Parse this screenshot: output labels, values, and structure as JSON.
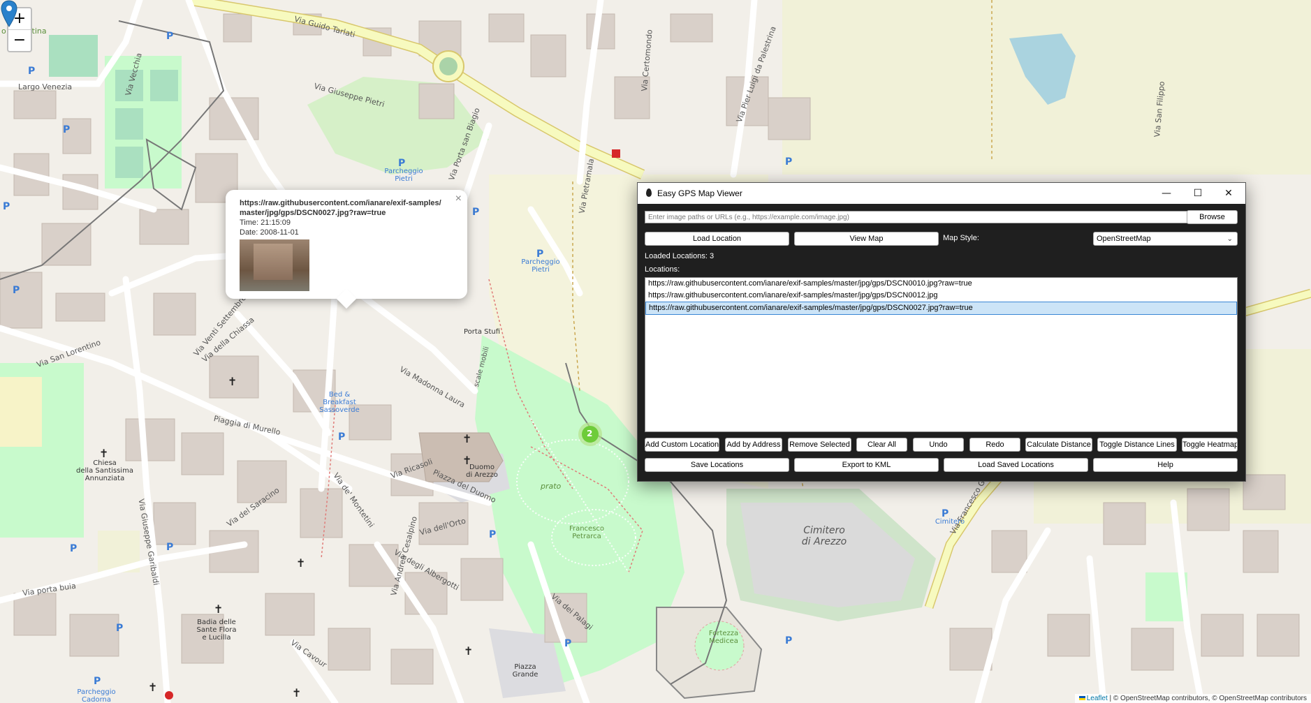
{
  "map": {
    "zoom_in": "+",
    "zoom_out": "−",
    "labels": {
      "via_guido_tarlati": "Via Guido Tarlati",
      "via_giuseppe_pietri": "Via Giuseppe Pietri",
      "via_madonna_laura": "Via Madonna Laura",
      "piaggia_di_murello": "Piaggia di Murello",
      "via_ricasoli": "Via Ricasoli",
      "piazza_del_duomo": "Piazza del Duomo",
      "duomo_di_arezzo": "Duomo\ndi Arezzo",
      "cimitero_di_arezzo": "Cimitero\ndi Arezzo",
      "porta_stufi": "Porta Stufi",
      "francesco_petrarca": "Francesco\nPetrarca",
      "fortezza_medicea": "Fortezza\nMedicea",
      "chiesa": "Chiesa\ndella Santissima\nAnnunziata",
      "badia": "Badia delle\nSante Flora\ne Lucilla",
      "bed_breakfast": "Bed &\nBreakfast\nSassoverde",
      "parcheggio_pietri": "Parcheggio\nPietri",
      "parcheggio_cadorna": "Parcheggio\nCadorna",
      "prato": "prato",
      "via_pietramala": "Via Pietramala",
      "via_cavour": "Via Cavour",
      "via_del_saracino": "Via del Saracino",
      "largo_venezia": "Largo Venezia",
      "via_vecchia": "Via Vecchia",
      "via_porta_buia": "Via porta buia",
      "via_dell_orto": "Via dell'Orto",
      "via_francesco_gamurrini": "Via Francesco Gamurrini",
      "via_san_filippo": "Via San Filippo",
      "via_certomondo": "Via Certomondo",
      "via_pier_luigi": "Via Pier Luigi da Palestrina",
      "via_porta_san_biagio": "Via Porta san Biagio",
      "via_san_lorentino": "Via San Lorentino",
      "via_venti_settembre": "Via Venti Settembre",
      "via_della_chiassa": "Via della Chiassa",
      "cimitero": "Cimitero",
      "piazza_grande": "Piazza\nGrande",
      "via_de_montetini": "Via de' Montetini",
      "via_andrea_cesalpino": "Via Andrea Cesalpino",
      "via_degli_albergotti": "Via degli Albergotti",
      "via_dei_palagi": "Via dei Palagi",
      "via_giuseppe_garibaldi": "Via Giuseppe Garibaldi",
      "fiorentina": "o Fiorentina",
      "scale_mobili": "scale mobili",
      "cluster": "2"
    },
    "attribution_leaflet": "Leaflet",
    "attribution_rest": " | © OpenStreetMap contributors, © OpenStreetMap contributors"
  },
  "popup": {
    "close": "×",
    "url": "https://raw.githubusercontent.com/ianare/exif-samples/master/jpg/gps/DSCN0027.jpg?raw=true",
    "time": "Time: 21:15:09",
    "date": "Date: 2008-11-01"
  },
  "window": {
    "title": "Easy GPS Map Viewer",
    "minimize": "—",
    "maximize": "☐",
    "close": "✕",
    "input_placeholder": "Enter image paths or URLs (e.g., https://example.com/image.jpg)",
    "browse": "Browse",
    "load_location": "Load Location",
    "view_map": "View Map",
    "map_style_label": "Map Style:",
    "map_style_value": "OpenStreetMap",
    "loaded_locations": "Loaded Locations: 3",
    "locations_label": "Locations:",
    "locations": [
      "https://raw.githubusercontent.com/ianare/exif-samples/master/jpg/gps/DSCN0010.jpg?raw=true",
      "https://raw.githubusercontent.com/ianare/exif-samples/master/jpg/gps/DSCN0012.jpg",
      "https://raw.githubusercontent.com/ianare/exif-samples/master/jpg/gps/DSCN0027.jpg?raw=true"
    ],
    "buttons_row1": [
      "Add Custom Location",
      "Add by Address",
      "Remove Selected",
      "Clear All",
      "Undo",
      "Redo",
      "Calculate Distance",
      "Toggle Distance Lines",
      "Toggle Heatmap"
    ],
    "buttons_row2": [
      "Save Locations",
      "Export to KML",
      "Load Saved Locations",
      "Help"
    ]
  }
}
